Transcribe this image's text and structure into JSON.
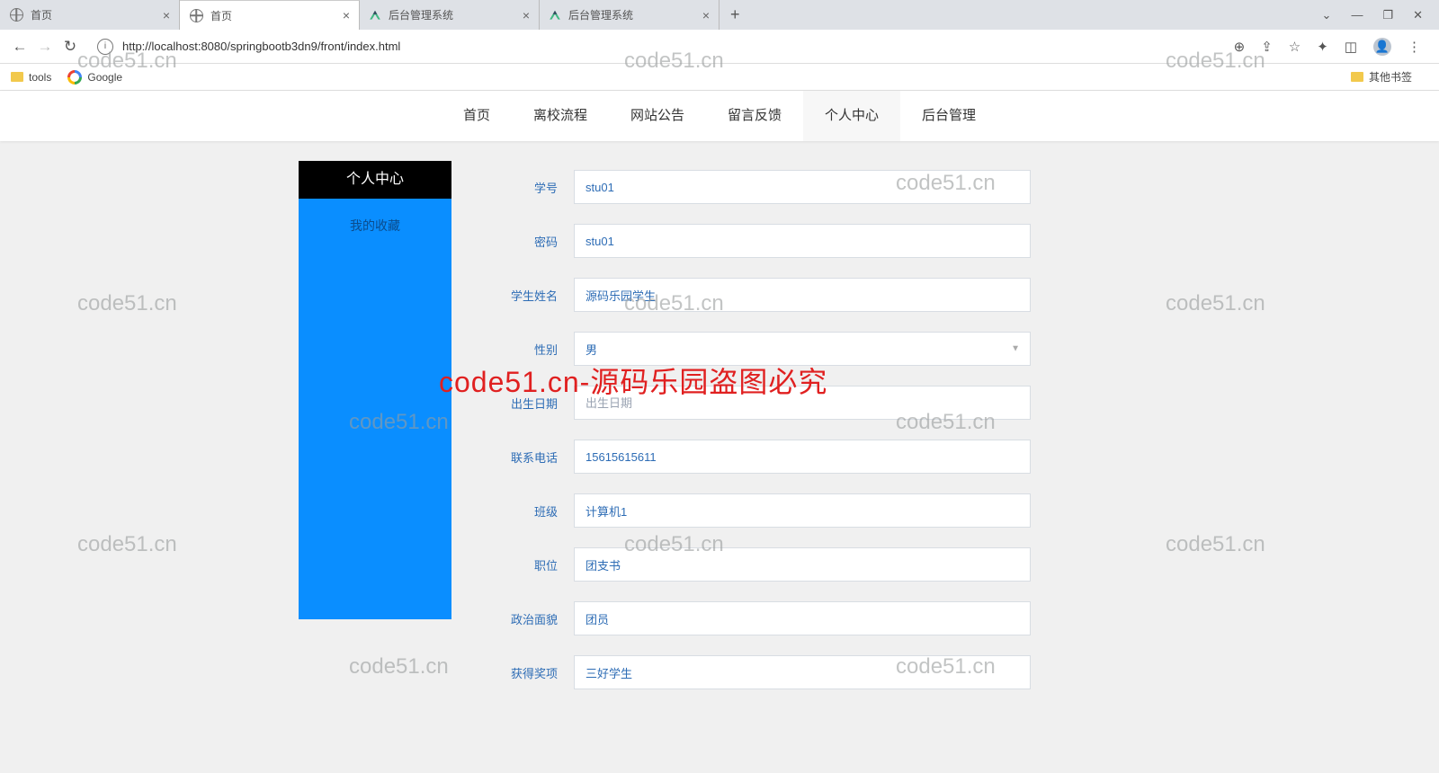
{
  "browser": {
    "tabs": [
      {
        "title": "首页",
        "icon": "globe"
      },
      {
        "title": "首页",
        "icon": "globe"
      },
      {
        "title": "后台管理系统",
        "icon": "vue"
      },
      {
        "title": "后台管理系统",
        "icon": "vue"
      }
    ],
    "url": "http://localhost:8080/springbootb3dn9/front/index.html",
    "bookmarks": {
      "tools": "tools",
      "google": "Google",
      "other": "其他书签"
    }
  },
  "nav": {
    "items": [
      "首页",
      "离校流程",
      "网站公告",
      "留言反馈",
      "个人中心",
      "后台管理"
    ],
    "active_index": 4
  },
  "sidebar": {
    "header": "个人中心",
    "link": "我的收藏"
  },
  "form": {
    "student_id": {
      "label": "学号",
      "value": "stu01"
    },
    "password": {
      "label": "密码",
      "value": "stu01"
    },
    "name": {
      "label": "学生姓名",
      "value": "源码乐园学生"
    },
    "gender": {
      "label": "性别",
      "value": "男"
    },
    "birthdate": {
      "label": "出生日期",
      "placeholder": "出生日期"
    },
    "phone": {
      "label": "联系电话",
      "value": "15615615611"
    },
    "class": {
      "label": "班级",
      "value": "计算机1"
    },
    "position": {
      "label": "职位",
      "value": "团支书"
    },
    "political": {
      "label": "政治面貌",
      "value": "团员"
    },
    "award": {
      "label": "获得奖项",
      "value": "三好学生"
    }
  },
  "watermarks": {
    "text": "code51.cn",
    "red_text": "code51.cn-源码乐园盗图必究"
  }
}
